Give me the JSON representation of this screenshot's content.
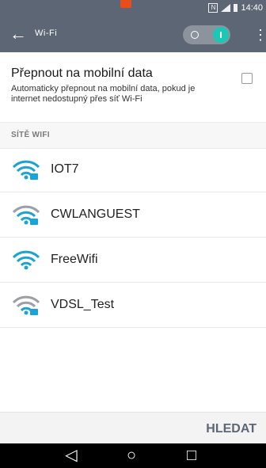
{
  "status_bar": {
    "time": "14:40"
  },
  "toolbar": {
    "back_icon": "arrow-left-icon",
    "title": "Wi-Fi",
    "toggle": "on",
    "more_icon": "more-vert-icon"
  },
  "mobile_data": {
    "title": "Přepnout na mobilní data",
    "description": "Automaticky přepnout na mobilní data, pokud je internet nedostupný přes síť Wi-Fi",
    "checked": false
  },
  "section_header": "SÍTĚ WIFI",
  "networks": [
    {
      "name": "IOT7"
    },
    {
      "name": "CWLANGUEST"
    },
    {
      "name": "FreeWifi"
    },
    {
      "name": "VDSL_Test"
    }
  ],
  "footer": {
    "scan_label": "HLEDAT"
  },
  "navbar": {
    "back_icon": "nav-back-icon",
    "home_icon": "nav-home-icon",
    "recents_icon": "nav-recents-icon"
  },
  "colors": {
    "bar": "#5d6674",
    "accent": "#1aa3d6",
    "toggle": "#19c8b7",
    "marker": "#e84d1c"
  }
}
